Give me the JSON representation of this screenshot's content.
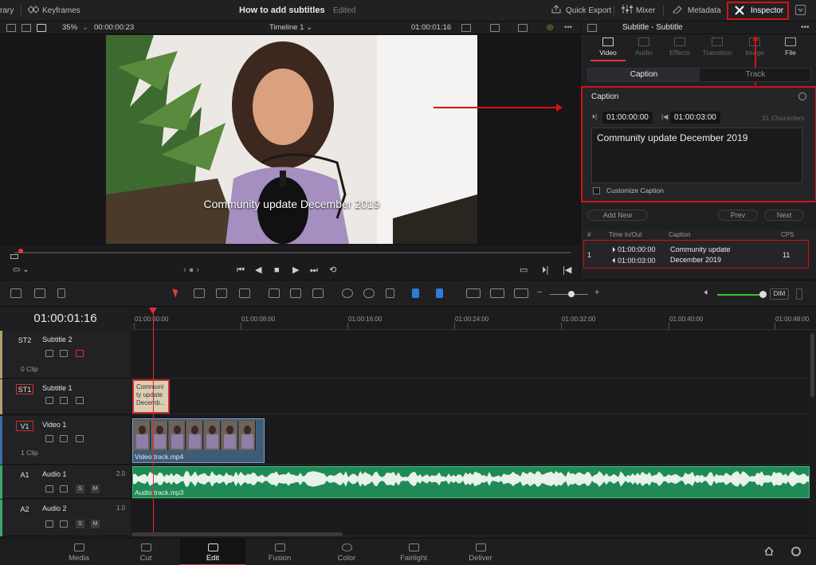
{
  "topbar": {
    "library": "rary",
    "keyframes": "Keyframes",
    "title": "How to add subtitles",
    "edited": "Edited",
    "quick_export": "Quick Export",
    "mixer": "Mixer",
    "metadata": "Metadata",
    "inspector": "Inspector"
  },
  "viewer": {
    "zoom": "35%",
    "timecode_left": "00:00:00:23",
    "timeline_name": "Timeline 1",
    "timecode_right": "01:00:01:16",
    "subtitle_text": "Community update December 2019"
  },
  "inspector": {
    "header_title": "Subtitle - Subtitle",
    "tabs": [
      "Video",
      "Audio",
      "Effects",
      "Transition",
      "Image",
      "File"
    ],
    "seg_caption": "Caption",
    "seg_track": "Track",
    "caption_label": "Caption",
    "tc_in": "01:00:00:00",
    "tc_out": "01:00:03:00",
    "characters": "31 Characters",
    "caption_text": "Community update December 2019",
    "customize": "Customize Caption",
    "add_new": "Add New",
    "prev": "Prev",
    "next": "Next",
    "list_headers": {
      "num": "#",
      "time": "Time In/Out",
      "caption": "Caption",
      "cps": "CPS"
    },
    "list_row": {
      "num": "1",
      "in": "01:00:00:00",
      "out": "01:00:03:00",
      "caption_line1": "Community update",
      "caption_line2": "December 2019",
      "cps": "11"
    }
  },
  "timeline": {
    "timecode": "01:00:01:16",
    "ruler": [
      "01:00:00:00",
      "01:00:08:00",
      "01:00:16:00",
      "01:00:24:00",
      "01:00:32:00",
      "01:00:40:00",
      "01:00:48:00"
    ],
    "dim": "DIM",
    "tracks": {
      "st2": {
        "id": "ST2",
        "name": "Subtitle 2",
        "clips": "0 Clip"
      },
      "st1": {
        "id": "ST1",
        "name": "Subtitle 1"
      },
      "v1": {
        "id": "V1",
        "name": "Video 1",
        "clips": "1 Clip"
      },
      "a1": {
        "id": "A1",
        "name": "Audio 1",
        "level": "2.0"
      },
      "a2": {
        "id": "A2",
        "name": "Audio 2",
        "level": "1.0"
      }
    },
    "sub_clip_text": "Community update December",
    "sub_clip_lines": [
      "Communi",
      "ty update",
      "Decemb..."
    ],
    "video_clip": "Video track.mp4",
    "audio_clip": "Audio track.mp3"
  },
  "nav": [
    "Media",
    "Cut",
    "Edit",
    "Fusion",
    "Color",
    "Fairlight",
    "Deliver"
  ],
  "colors": {
    "accent": "#e12f2f",
    "highlight_box": "#d31212",
    "audio_clip": "#1f8a55",
    "video_clip": "#3e5c78",
    "volume": "#37c02d"
  },
  "icons": [
    "keyframes-icon",
    "quick-export-icon",
    "mixer-icon",
    "metadata-icon",
    "inspector-icon",
    "home-icon",
    "gear-icon"
  ]
}
